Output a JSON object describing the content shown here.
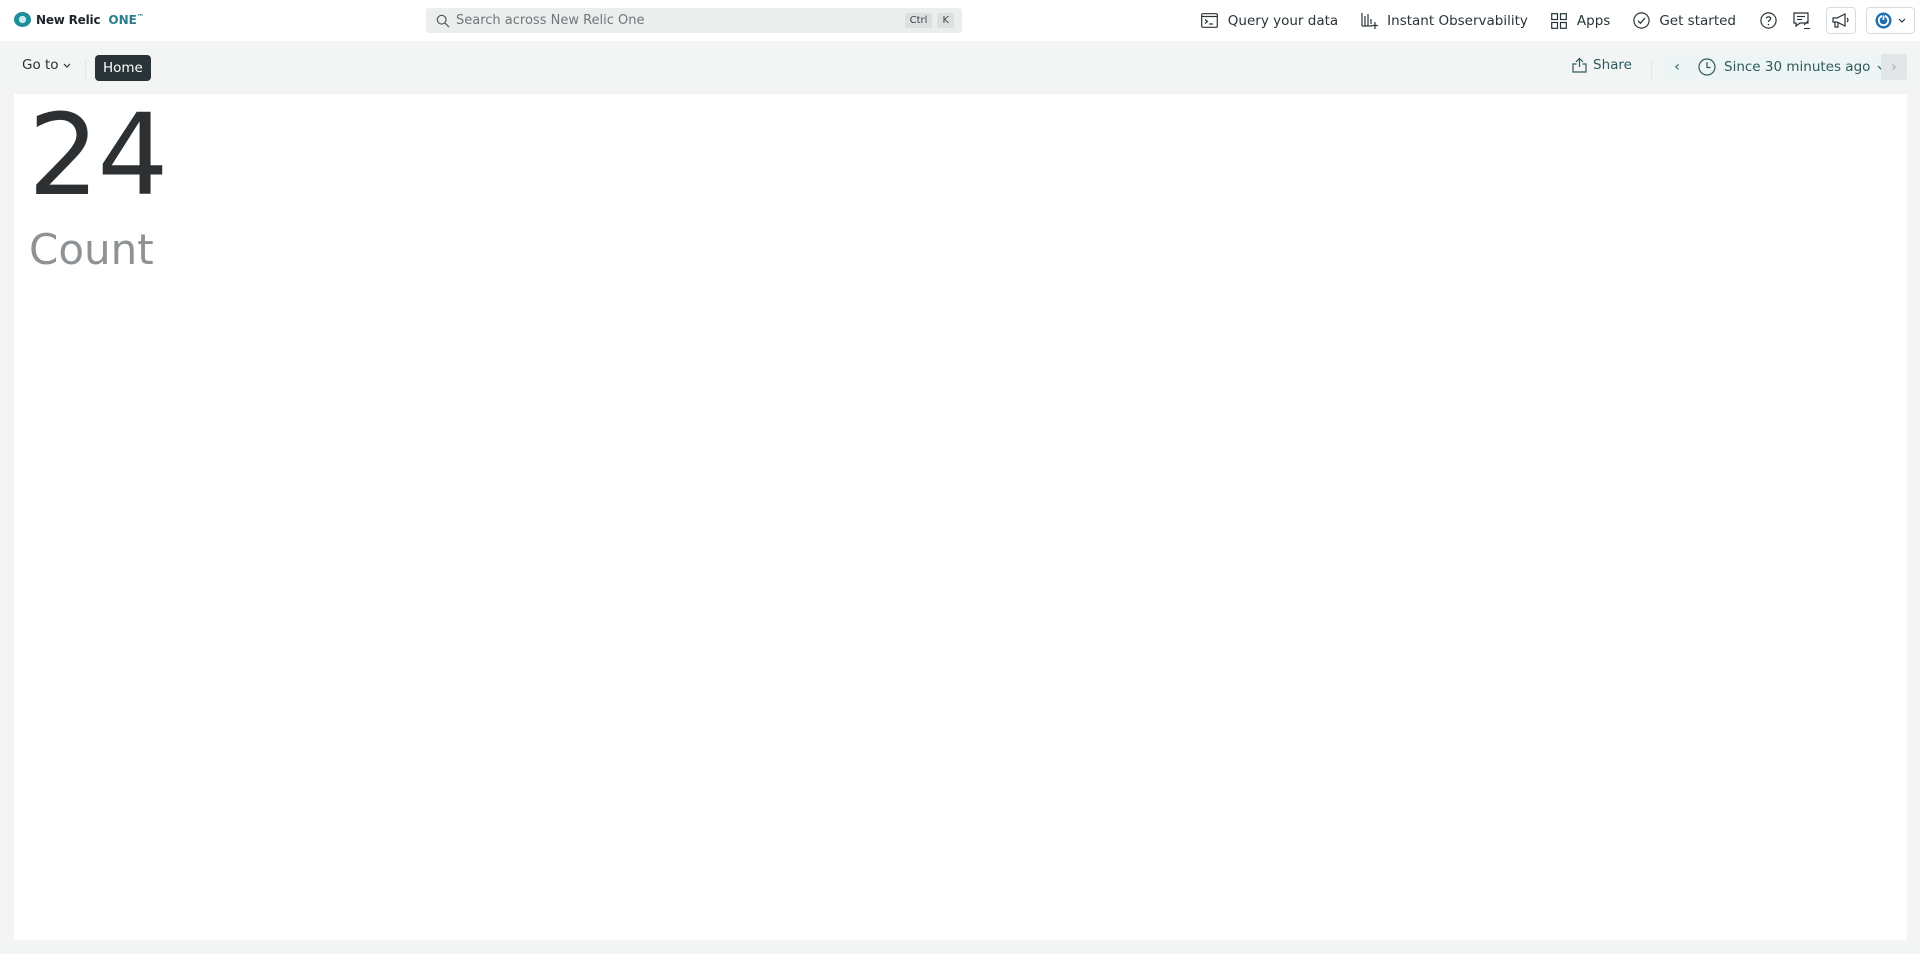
{
  "topbar": {
    "logo_text": "New Relic",
    "logo_one": "ONE",
    "logo_tm": "™",
    "search_placeholder": "Search across New Relic One",
    "shortcut_keys": [
      "Ctrl",
      "K"
    ],
    "nav": [
      {
        "label": "Query your data",
        "icon": "terminal-icon"
      },
      {
        "label": "Instant Observability",
        "icon": "chart-plus-icon"
      },
      {
        "label": "Apps",
        "icon": "apps-grid-icon"
      },
      {
        "label": "Get started",
        "icon": "check-circle-icon"
      }
    ],
    "icon_buttons": [
      "help-icon",
      "feedback-icon",
      "announcement-icon",
      "user-menu-icon"
    ]
  },
  "subbar": {
    "goto_label": "Go to",
    "home_label": "Home",
    "share_label": "Share",
    "time_range": "Since 30 minutes ago",
    "prev_symbol": "‹",
    "next_symbol": "›"
  },
  "billboard": {
    "value": "24",
    "label": "Count"
  },
  "colors": {
    "accent": "#2e5a5c",
    "brand": "#1d8e99",
    "home_pill": "#293338"
  }
}
